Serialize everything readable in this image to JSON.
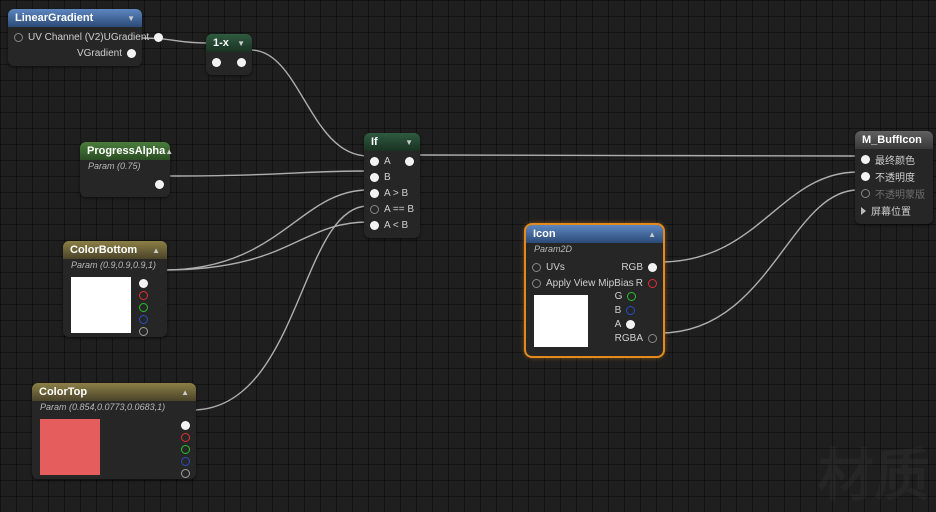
{
  "nodes": {
    "linearGradient": {
      "title": "LinearGradient",
      "inputs": {
        "uvChannel": "UV Channel (V2)"
      },
      "outputs": {
        "u": "UGradient",
        "v": "VGradient"
      }
    },
    "oneMinus": {
      "title": "1-x"
    },
    "progressAlpha": {
      "title": "ProgressAlpha",
      "param": "Param (0.75)"
    },
    "ifNode": {
      "title": "If",
      "pins": {
        "a": "A",
        "b": "B",
        "agtb": "A > B",
        "aeqb": "A == B",
        "altb": "A < B"
      }
    },
    "colorBottom": {
      "title": "ColorBottom",
      "param": "Param (0.9,0.9,0.9,1)"
    },
    "colorTop": {
      "title": "ColorTop",
      "param": "Param (0.854,0.0773,0.0683,1)"
    },
    "icon": {
      "title": "Icon",
      "param": "Param2D",
      "inputs": {
        "uvs": "UVs",
        "mipbias": "Apply View MipBias"
      },
      "outputs": {
        "rgb": "RGB",
        "r": "R",
        "g": "G",
        "b": "B",
        "a": "A",
        "rgba": "RGBA"
      }
    },
    "result": {
      "title": "M_BuffIcon",
      "pins": {
        "finalColor": "最终颜色",
        "opacity": "不透明度",
        "opacityMask": "不透明蒙版",
        "screenPos": "屏幕位置"
      }
    }
  },
  "watermark": "材质"
}
